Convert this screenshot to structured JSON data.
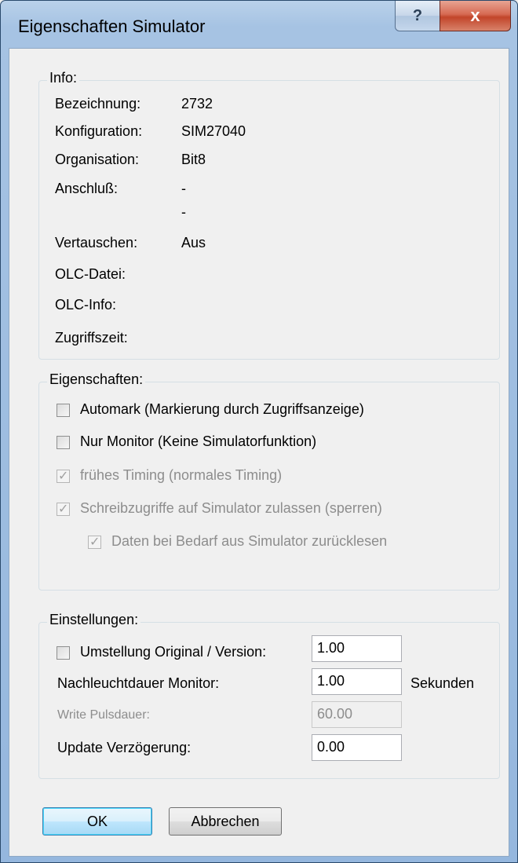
{
  "window": {
    "title": "Eigenschaften Simulator",
    "help_label": "?",
    "close_label": "x"
  },
  "info": {
    "group_label": "Info:",
    "rows": [
      {
        "label": "Bezeichnung:",
        "value": "2732"
      },
      {
        "label": "Konfiguration:",
        "value": "SIM27040"
      },
      {
        "label": "Organisation:",
        "value": "Bit8"
      },
      {
        "label": "Anschluß:",
        "value": "-"
      },
      {
        "label": "",
        "value": "-"
      },
      {
        "label": "Vertauschen:",
        "value": "Aus"
      },
      {
        "label": "OLC-Datei:",
        "value": ""
      },
      {
        "label": "OLC-Info:",
        "value": ""
      },
      {
        "label": "Zugriffszeit:",
        "value": ""
      }
    ]
  },
  "eigenschaften": {
    "group_label": "Eigenschaften:",
    "options": [
      {
        "label": "Automark (Markierung durch Zugriffsanzeige)",
        "checked": false,
        "enabled": true
      },
      {
        "label": "Nur Monitor (Keine Simulatorfunktion)",
        "checked": false,
        "enabled": true
      },
      {
        "label": "frühes Timing (normales Timing)",
        "checked": true,
        "enabled": false
      },
      {
        "label": "Schreibzugriffe auf Simulator zulassen (sperren)",
        "checked": true,
        "enabled": false
      },
      {
        "label": "Daten bei Bedarf aus Simulator zurücklesen",
        "checked": true,
        "enabled": false
      }
    ]
  },
  "einstellungen": {
    "group_label": "Einstellungen:",
    "umstellung": {
      "label": "Umstellung Original / Version:",
      "checked": false,
      "value": "1.00"
    },
    "nachleuchtdauer": {
      "label": "Nachleuchtdauer Monitor:",
      "value": "1.00",
      "unit": "Sekunden"
    },
    "write_pulsdauer": {
      "label": "Write Pulsdauer:",
      "value": "60.00"
    },
    "update": {
      "label": "Update Verzögerung:",
      "value": "0.00"
    }
  },
  "buttons": {
    "ok": "OK",
    "cancel": "Abbrechen"
  }
}
